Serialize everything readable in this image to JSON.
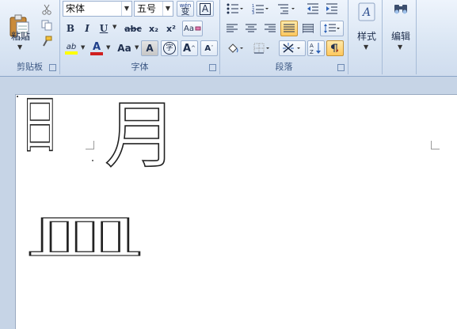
{
  "clipboard": {
    "paste_label": "粘贴",
    "group_label": "剪贴板"
  },
  "font": {
    "name": "宋体",
    "size": "五号",
    "phonetic_char": "wén",
    "phonetic_char_main": "变",
    "border_char": "A",
    "bold": "B",
    "italic": "I",
    "underline": "U",
    "strike": "abc",
    "sub": "x₂",
    "sup": "x²",
    "clear": "Aa",
    "highlight": "ab",
    "color": "A",
    "case": "Aa",
    "shade": "A",
    "encircle": "字",
    "grow": "A",
    "shrink": "A",
    "group_label": "字体"
  },
  "paragraph": {
    "group_label": "段落"
  },
  "styles": {
    "label": "样式",
    "glyph": "A"
  },
  "editing": {
    "label": "编辑"
  },
  "document": {
    "glyph_ri": "日",
    "glyph_yue": "月",
    "glyph_min": "皿"
  },
  "colors": {
    "accent": "#ffc85e",
    "ribbon": "#d9e5f3",
    "page": "#ffffff",
    "highlight_yellow": "#ffff00",
    "font_red": "#d02020"
  }
}
